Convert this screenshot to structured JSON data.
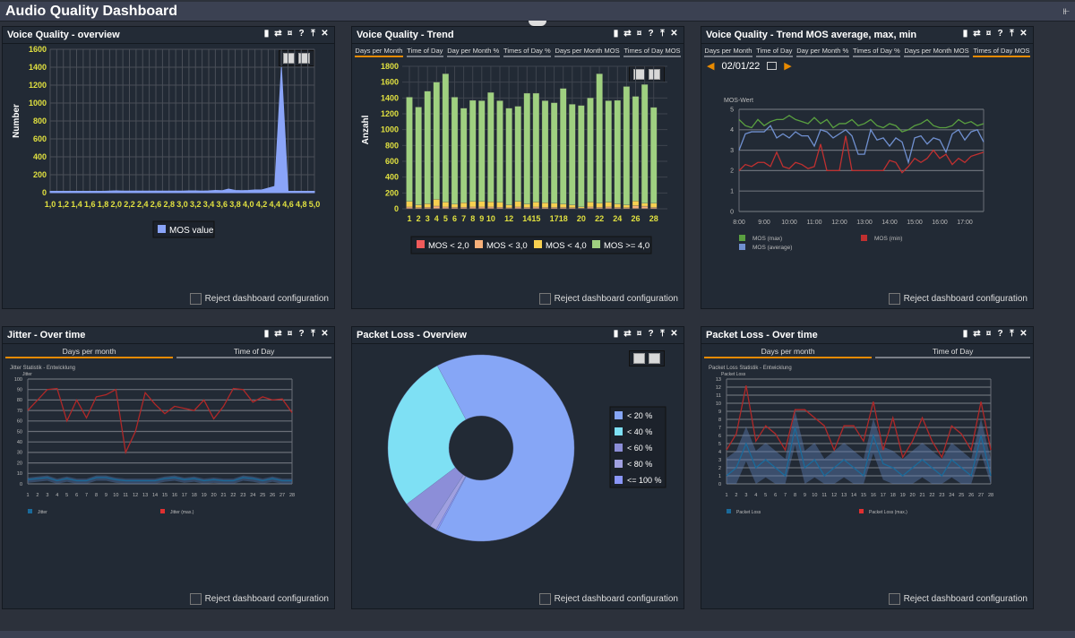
{
  "header": {
    "title": "Audio Quality Dashboard",
    "collapse_icon": "double-chevron-down-icon"
  },
  "panel_icons": {
    "copy": "▮",
    "refresh": "⇄",
    "maximize": "¤",
    "help": "?",
    "pin": "⤒",
    "close": "✕"
  },
  "reject_label": "Reject dashboard configuration",
  "panels": {
    "overview": {
      "title": "Voice Quality - overview"
    },
    "trend": {
      "title": "Voice Quality - Trend",
      "tabs": [
        "Days per Month",
        "Time of Day",
        "Day per Month %",
        "Times of Day %",
        "Days per Month MOS",
        "Times of Day MOS"
      ],
      "active_tab": 0
    },
    "mos": {
      "title": "Voice Quality - Trend MOS average, max, min",
      "tabs": [
        "Days per Month",
        "Time of Day",
        "Day per Month %",
        "Times of Day %",
        "Days per Month MOS",
        "Times of Day MOS"
      ],
      "active_tab": 5,
      "date": "02/01/22"
    },
    "jitter": {
      "title": "Jitter - Over time",
      "tabs": [
        "Days per month",
        "Time of Day"
      ],
      "active_tab": 0
    },
    "ploss": {
      "title": "Packet Loss - Overview"
    },
    "plosstime": {
      "title": "Packet Loss - Over time",
      "tabs": [
        "Days per month",
        "Time of Day"
      ],
      "active_tab": 0
    }
  },
  "chart_data": [
    {
      "type": "area",
      "ylabel": "Number",
      "ylim": [
        0,
        1600
      ],
      "yticks": [
        0,
        200,
        400,
        600,
        800,
        1000,
        1200,
        1400,
        1600
      ],
      "x": [
        1.0,
        1.1,
        1.2,
        1.3,
        1.4,
        1.5,
        1.6,
        1.7,
        1.8,
        1.9,
        2.0,
        2.1,
        2.2,
        2.3,
        2.4,
        2.5,
        2.6,
        2.7,
        2.8,
        2.9,
        3.0,
        3.1,
        3.2,
        3.3,
        3.4,
        3.5,
        3.6,
        3.7,
        3.8,
        3.9,
        4.0,
        4.1,
        4.2,
        4.3,
        4.4,
        4.5,
        4.6,
        4.7,
        4.8,
        4.9,
        5.0
      ],
      "xticks": [
        "1,0",
        "1,2",
        "1,4",
        "1,6",
        "1,8",
        "2,0",
        "2,2",
        "2,4",
        "2,6",
        "2,8",
        "3,0",
        "3,2",
        "3,4",
        "3,6",
        "3,8",
        "4,0",
        "4,2",
        "4,4",
        "4,6",
        "4,8",
        "5,0"
      ],
      "series": [
        {
          "name": "MOS value",
          "color": "#8aa4f8",
          "values": [
            15,
            15,
            15,
            15,
            15,
            15,
            15,
            15,
            15,
            18,
            20,
            18,
            18,
            18,
            18,
            18,
            18,
            18,
            18,
            18,
            18,
            20,
            20,
            18,
            20,
            25,
            22,
            40,
            25,
            22,
            25,
            30,
            30,
            50,
            70,
            1400,
            15,
            15,
            15,
            15,
            15
          ]
        }
      ],
      "grid": true,
      "legend": "bottom"
    },
    {
      "type": "bar",
      "stacked": true,
      "ylabel": "Anzahl",
      "ylim": [
        0,
        1800
      ],
      "yticks": [
        0,
        200,
        400,
        600,
        800,
        1000,
        1200,
        1400,
        1600,
        1800
      ],
      "categories": [
        "1",
        "2",
        "3",
        "4",
        "5",
        "6",
        "7",
        "8",
        "9",
        "10",
        "11",
        "12",
        "13",
        "14",
        "15",
        "16",
        "17",
        "18",
        "19",
        "20",
        "21",
        "22",
        "23",
        "24",
        "25",
        "26",
        "27",
        "28"
      ],
      "xtick_labels": [
        "1",
        "2",
        "3",
        "4",
        "5",
        "6",
        "7",
        "8",
        "9",
        "10",
        "",
        "12",
        "",
        "14",
        "15",
        "",
        "17",
        "18",
        "",
        "20",
        "",
        "22",
        "",
        "24",
        "",
        "26",
        "",
        "28"
      ],
      "series": [
        {
          "name": "MOS < 2,0",
          "color": "#f05a5a",
          "values": [
            3,
            2,
            3,
            4,
            3,
            2,
            2,
            3,
            3,
            3,
            2,
            2,
            3,
            2,
            3,
            2,
            2,
            2,
            2,
            1,
            3,
            2,
            3,
            2,
            2,
            4,
            3,
            2
          ]
        },
        {
          "name": "MOS < 3,0",
          "color": "#f7b07a",
          "values": [
            20,
            12,
            15,
            30,
            20,
            15,
            18,
            20,
            20,
            20,
            18,
            10,
            20,
            15,
            20,
            15,
            15,
            15,
            12,
            8,
            20,
            15,
            20,
            15,
            12,
            35,
            30,
            15
          ]
        },
        {
          "name": "MOS < 4,0",
          "color": "#f7d050",
          "values": [
            70,
            35,
            45,
            85,
            62,
            42,
            57,
            70,
            70,
            65,
            62,
            35,
            70,
            43,
            62,
            60,
            53,
            43,
            35,
            15,
            62,
            53,
            60,
            43,
            35,
            60,
            37,
            53
          ]
        },
        {
          "name": "MOS >= 4,0",
          "color": "#9fd080",
          "values": [
            1317,
            1236,
            1422,
            1481,
            1620,
            1351,
            1193,
            1277,
            1272,
            1382,
            1283,
            1223,
            1202,
            1400,
            1375,
            1288,
            1270,
            1460,
            1271,
            1281,
            1315,
            1635,
            1282,
            1310,
            1496,
            1321,
            1500,
            1210
          ]
        }
      ],
      "grid": true,
      "legend": "bottom"
    },
    {
      "type": "line",
      "ylabel": "MOS-Wert",
      "ylim": [
        0,
        5
      ],
      "yticks": [
        0,
        1,
        2,
        3,
        4,
        5
      ],
      "xticks": [
        "8:00",
        "9:00",
        "10:00",
        "11:00",
        "12:00",
        "13:00",
        "14:00",
        "15:00",
        "16:00",
        "17:00"
      ],
      "series": [
        {
          "name": "MOS (max)",
          "color": "#5aa040",
          "values": [
            4.5,
            4.2,
            4.1,
            4.5,
            4.2,
            4.4,
            4.5,
            4.5,
            4.7,
            4.5,
            4.4,
            4.3,
            4.6,
            4.3,
            4.5,
            4.1,
            4.3,
            4.3,
            4.5,
            4.2,
            4.3,
            4.5,
            4.2,
            4.1,
            4.3,
            4.2,
            3.9,
            4.0,
            4.2,
            4.3,
            4.5,
            4.2,
            4.1,
            4.1,
            4.2,
            4.5,
            4.3,
            4.4,
            4.2,
            4.3
          ]
        },
        {
          "name": "MOS (average)",
          "color": "#7090d0",
          "values": [
            3.0,
            3.8,
            3.9,
            3.9,
            3.9,
            4.2,
            3.6,
            3.8,
            3.6,
            3.9,
            3.7,
            3.7,
            3.2,
            4.0,
            3.9,
            3.6,
            3.8,
            4.0,
            3.7,
            2.8,
            2.8,
            4.0,
            3.5,
            3.6,
            3.2,
            3.6,
            3.4,
            2.4,
            3.6,
            3.7,
            3.3,
            3.6,
            3.5,
            2.9,
            3.8,
            4.0,
            3.5,
            3.9,
            4.0,
            3.4
          ]
        },
        {
          "name": "MOS (min)",
          "color": "#c03030",
          "values": [
            2.0,
            2.3,
            2.2,
            2.4,
            2.4,
            2.2,
            2.9,
            2.2,
            2.1,
            2.4,
            2.3,
            2.1,
            2.2,
            3.3,
            2.0,
            2.0,
            2.0,
            3.7,
            2.0,
            2.0,
            2.0,
            2.0,
            2.0,
            2.0,
            2.5,
            2.4,
            1.9,
            2.2,
            2.6,
            2.4,
            2.6,
            3.0,
            2.6,
            2.8,
            2.3,
            2.6,
            2.4,
            2.7,
            2.8,
            2.9
          ]
        }
      ],
      "grid": true,
      "legend": "bottom"
    },
    {
      "type": "line",
      "title": "Jitter Statistik - Entwicklung",
      "ylabel": "Jitter",
      "ylim": [
        0,
        100
      ],
      "yticks": [
        0,
        10,
        20,
        30,
        40,
        50,
        60,
        70,
        80,
        90,
        100
      ],
      "categories": [
        "1",
        "2",
        "3",
        "4",
        "5",
        "6",
        "7",
        "8",
        "9",
        "10",
        "11",
        "12",
        "13",
        "14",
        "15",
        "16",
        "17",
        "18",
        "19",
        "20",
        "21",
        "22",
        "23",
        "24",
        "25",
        "26",
        "27",
        "28"
      ],
      "series": [
        {
          "name": "Jitter",
          "color": "#1a6a9a",
          "values": [
            4,
            5,
            6,
            3,
            5,
            3,
            3,
            6,
            6,
            4,
            3,
            3,
            3,
            3,
            5,
            6,
            4,
            5,
            3,
            4,
            3,
            3,
            6,
            5,
            3,
            5,
            3,
            3
          ]
        },
        {
          "name": "Jitter (max.)",
          "color": "#b02828",
          "values": [
            70,
            80,
            90,
            91,
            60,
            80,
            63,
            83,
            85,
            90,
            30,
            50,
            87,
            76,
            67,
            74,
            72,
            70,
            80,
            62,
            74,
            91,
            90,
            78,
            83,
            80,
            81,
            68
          ]
        }
      ],
      "grid": true,
      "legend": "bottom"
    },
    {
      "type": "pie",
      "donut": true,
      "labels": [
        "< 20 %",
        "< 40 %",
        "< 60 %",
        "< 80 %",
        "<= 100 %"
      ],
      "values": [
        65.5,
        27.5,
        5.5,
        1.2,
        0.3
      ],
      "colors": [
        "#86a6f6",
        "#7ee0f4",
        "#8c8ed8",
        "#a0a0e0",
        "#8a96f8"
      ],
      "legend": "right"
    },
    {
      "type": "line",
      "title": "Packet Loss Statistik - Entwicklung",
      "ylabel": "Packet Loss",
      "ylim": [
        0,
        13
      ],
      "yticks": [
        0,
        1,
        2,
        3,
        4,
        5,
        6,
        7,
        8,
        9,
        10,
        11,
        12,
        13
      ],
      "categories": [
        "1",
        "2",
        "3",
        "4",
        "5",
        "6",
        "7",
        "8",
        "9",
        "10",
        "11",
        "12",
        "13",
        "14",
        "15",
        "16",
        "17",
        "18",
        "19",
        "20",
        "21",
        "22",
        "23",
        "24",
        "25",
        "26",
        "27",
        "28"
      ],
      "series": [
        {
          "name": "Packet Loss",
          "color": "#1a6a9a",
          "values": [
            1,
            2,
            5,
            2,
            3,
            2,
            1,
            7,
            2,
            3,
            1,
            2,
            3,
            2,
            1,
            6,
            2.5,
            2,
            1,
            2,
            3,
            2,
            1,
            3,
            2,
            1,
            6,
            1
          ],
          "range_low": [
            0,
            0,
            2.8,
            0,
            0.8,
            0,
            0,
            4.8,
            0,
            0.8,
            0,
            0,
            0.8,
            0,
            0,
            3.8,
            0.5,
            0,
            0,
            0,
            0.8,
            0,
            0,
            0.8,
            0,
            0,
            3.8,
            0
          ],
          "range_high": [
            3.2,
            4.1,
            7.1,
            4.1,
            5.1,
            4.1,
            3.1,
            9.1,
            4.1,
            5.1,
            3.1,
            4.1,
            5.1,
            4.1,
            3.1,
            8.1,
            4.6,
            4.1,
            3.1,
            4.1,
            5.1,
            4.1,
            3.1,
            5.1,
            4.1,
            3.1,
            8.1,
            3.1
          ]
        },
        {
          "name": "Packet Loss (max.)",
          "color": "#b02828",
          "values": [
            4.2,
            6.2,
            12.2,
            5.3,
            7.2,
            6.2,
            4.2,
            9.2,
            9.2,
            8.2,
            7.2,
            4.2,
            7.2,
            7.2,
            5.3,
            10.2,
            4.2,
            8.2,
            3.3,
            5.3,
            8.2,
            5.3,
            3.3,
            7.2,
            6.2,
            4.2,
            10.2,
            4.2
          ]
        }
      ],
      "grid": true,
      "legend": "bottom"
    }
  ]
}
